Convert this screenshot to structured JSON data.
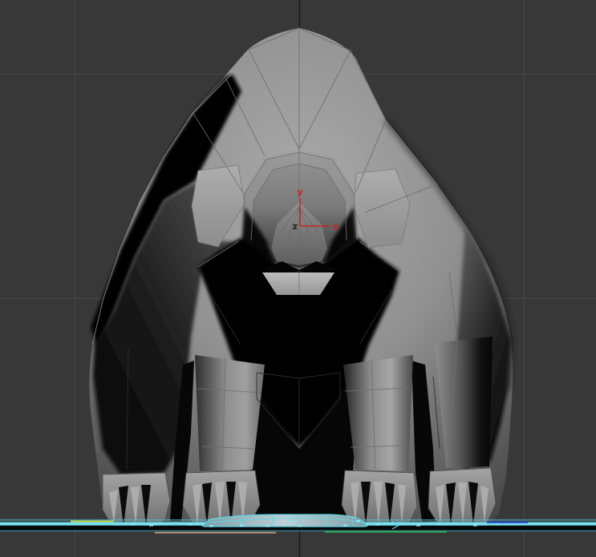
{
  "viewport": {
    "kind": "3d-perspective-viewport-front-view",
    "axis_gizmo": {
      "y_label": "y",
      "x_label": "x",
      "z_label": "z"
    },
    "colors": {
      "background": "#383838",
      "grid_line": "#474747",
      "grid_axis_dark": "#1a1a1a",
      "gizmo_red": "#c62420",
      "gizmo_z_dark": "#1f1f1f",
      "wireframe_gray": "#6f6f6f",
      "wireframe_dark": "#2e2e2e",
      "selection_cyan": "#5fd8ea",
      "selection_cyan_bright": "#86e7f5",
      "selection_cyan_dim": "#2e93a4",
      "ground_shadow_black": "#070707",
      "segment_yellow": "#c9cf3c",
      "segment_blue": "#2f55cc",
      "segment_tan": "#c9a183",
      "segment_green": "#2fae4a"
    }
  }
}
